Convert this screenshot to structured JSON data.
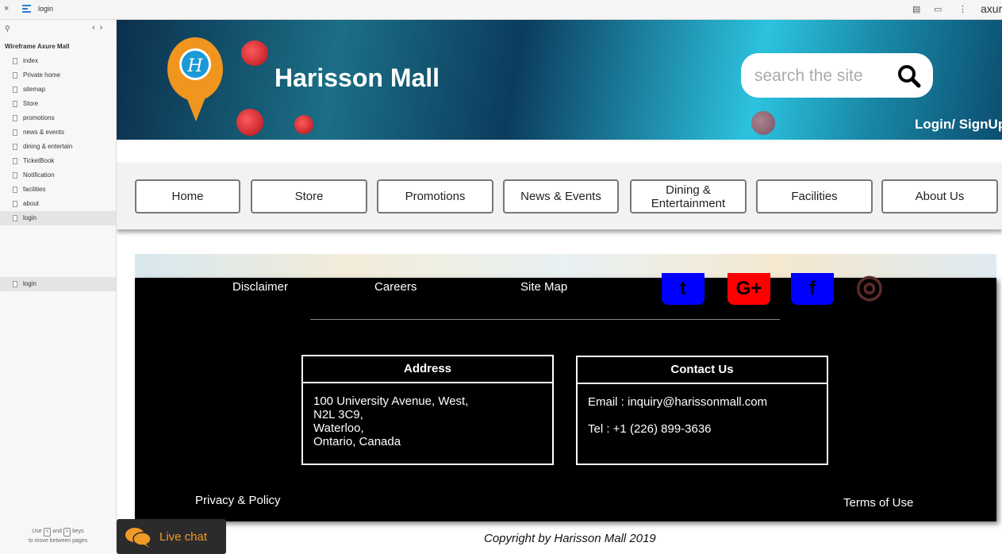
{
  "toolbar": {
    "close_glyph": "×",
    "page_name": "login",
    "brand": "axure"
  },
  "sidebar": {
    "project_title": "Wireframe Axure Mall",
    "pages": [
      "index",
      "Private home",
      "sitemap",
      "Store",
      "promotions",
      "news & events",
      "dining & entertain",
      "TicketBook",
      "Notification",
      "facilities",
      "about",
      "login"
    ],
    "active_page": "login",
    "lower_item": "login",
    "hint_use": "Use",
    "hint_and": "and",
    "hint_keys": "keys",
    "hint_line2": "to move between pages",
    "key_prev": "<",
    "key_next": ">"
  },
  "site": {
    "brand": "Harisson Mall",
    "logo_letter": "H",
    "search_placeholder": "search the site",
    "login_link": "Login/ SignUp",
    "nav": [
      "Home",
      "Store",
      "Promotions",
      "News & Events",
      "Dining & Entertainment",
      "Facilities",
      "About Us"
    ]
  },
  "footer": {
    "links": [
      "Disclaimer",
      "Careers",
      "Site Map"
    ],
    "social": [
      {
        "icon": "twitter-icon",
        "glyph": "t",
        "color": "#0000ff"
      },
      {
        "icon": "google-plus-icon",
        "glyph": "G+",
        "color": "#ff0000"
      },
      {
        "icon": "facebook-icon",
        "glyph": "f",
        "color": "#0000ff"
      },
      {
        "icon": "instagram-icon",
        "glyph": "◎",
        "color": "#5a2b2b"
      }
    ],
    "address_title": "Address",
    "address_lines": [
      "100 University Avenue, West,",
      "N2L 3C9,",
      "Waterloo,",
      "Ontario, Canada"
    ],
    "contact_title": "Contact Us",
    "email": "Email : inquiry@harissonmall.com",
    "phone": "Tel : +1 (226) 899-3636",
    "privacy": "Privacy & Policy",
    "terms": "Terms of Use"
  },
  "copyright": "Copyright by Harisson Mall  2019",
  "live_chat": "Live chat",
  "colors": {
    "accent": "#f0961e",
    "chat_text": "#f19a26"
  }
}
